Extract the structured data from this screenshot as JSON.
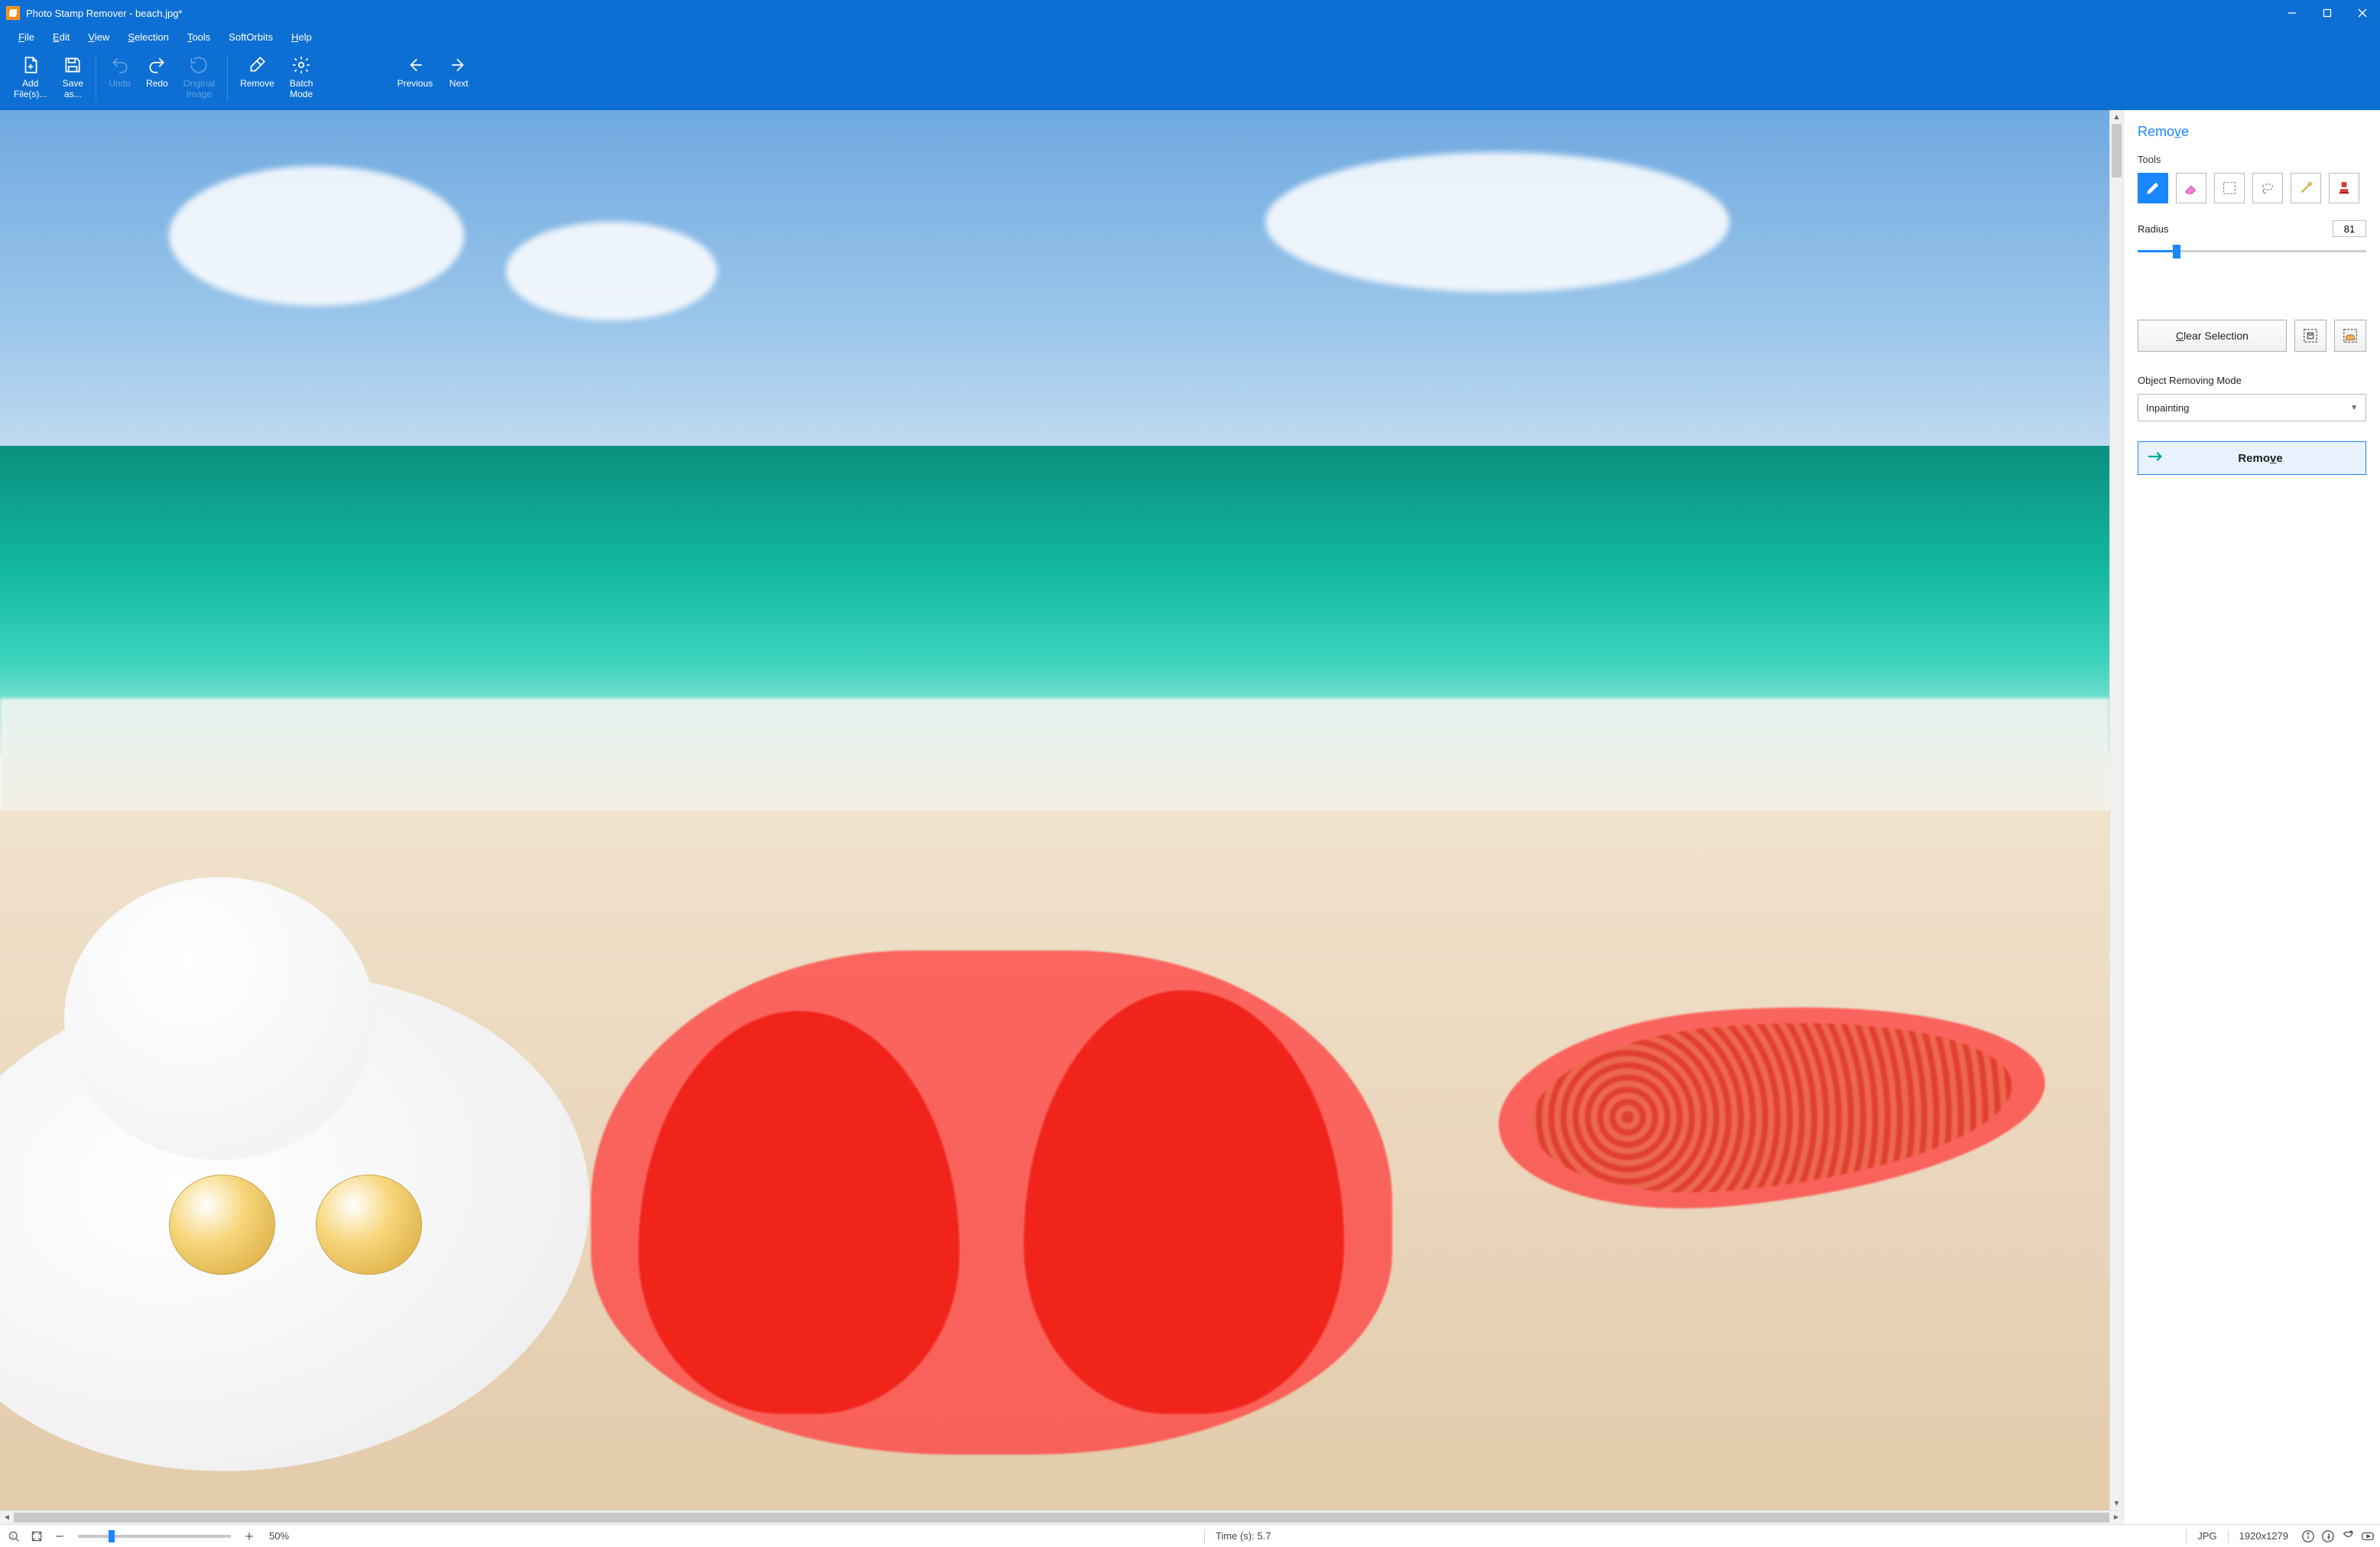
{
  "window": {
    "title": "Photo Stamp Remover - beach.jpg*"
  },
  "menu": {
    "file": {
      "label": "File",
      "u": "F"
    },
    "edit": {
      "label": "Edit",
      "u": "E"
    },
    "view": {
      "label": "View",
      "u": "V"
    },
    "selection": {
      "label": "Selection",
      "u": "S"
    },
    "tools": {
      "label": "Tools",
      "u": "T"
    },
    "softorbits": {
      "label": "SoftOrbits",
      "u": ""
    },
    "help": {
      "label": "Help",
      "u": "H"
    }
  },
  "ribbon": {
    "add_files": "Add\nFile(s)...",
    "save_as": "Save\nas...",
    "undo": "Undo",
    "redo": "Redo",
    "original": "Original\nImage",
    "remove": "Remove",
    "batch": "Batch\nMode",
    "previous": "Previous",
    "next": "Next"
  },
  "panel": {
    "title_pre": "Remo",
    "title_u": "v",
    "title_post": "e",
    "tools_label": "Tools",
    "tools": [
      "marker",
      "eraser",
      "rect-select",
      "lasso",
      "magic-wand",
      "stamp"
    ],
    "selected_tool_index": 0,
    "radius_label": "Radius",
    "radius_value": "81",
    "radius_percent": 17,
    "clear_pre": "",
    "clear_u": "C",
    "clear_post": "lear Selection",
    "mode_label": "Object Removing Mode",
    "mode_value": "Inpainting",
    "remove_pre": "Remo",
    "remove_u": "v",
    "remove_post": "e"
  },
  "status": {
    "zoom_text": "50%",
    "zoom_percent": 22,
    "time_label": "Time (s): 5.7",
    "format": "JPG",
    "dimensions": "1920x1279"
  }
}
